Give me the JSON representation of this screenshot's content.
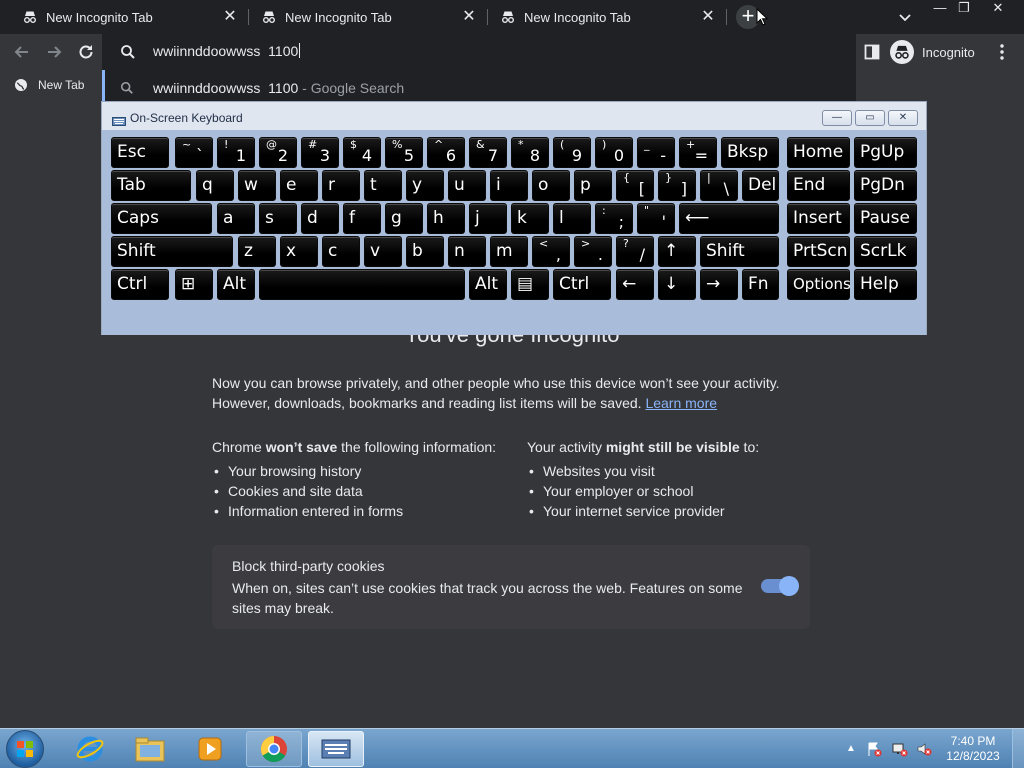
{
  "browser": {
    "tabs": [
      {
        "title": "New Incognito Tab",
        "close": "✕"
      },
      {
        "title": "New Incognito Tab",
        "close": "✕"
      },
      {
        "title": "New Incognito Tab",
        "close": "✕"
      }
    ],
    "new_tab_symbol": "+",
    "window_controls": {
      "minimize": "—",
      "maximize": "❐",
      "close": "✕"
    },
    "omnibox": {
      "value": "wwiinnddoowwss  1100"
    },
    "incognito_label": "Incognito",
    "bookmarks": [
      {
        "label": "New Tab"
      }
    ],
    "suggestion": {
      "query": "wwiinnddoowwss  1100",
      "suffix": " - Google Search"
    },
    "colors": {
      "tabstrip": "#202124",
      "toolbar": "#35363a",
      "accent": "#8ab4f8"
    }
  },
  "page": {
    "heading": "You've gone Incognito",
    "intro_line1": "Now you can browse privately, and other people who use this device won’t see your activity.",
    "intro_line2": "However, downloads, bookmarks and reading list items will be saved. ",
    "learn_more": "Learn more",
    "not_saved": {
      "heading_prefix": "Chrome ",
      "heading_bold": "won’t save",
      "heading_suffix": " the following information:",
      "items": [
        "Your browsing history",
        "Cookies and site data",
        "Information entered in forms"
      ]
    },
    "still_visible": {
      "heading_prefix": "Your activity ",
      "heading_bold": "might still be visible",
      "heading_suffix": " to:",
      "items": [
        "Websites you visit",
        "Your employer or school",
        "Your internet service provider"
      ]
    },
    "cookies": {
      "title": "Block third-party cookies",
      "desc": "When on, sites can’t use cookies that track you across the web. Features on some sites may break.",
      "toggle_on": true
    }
  },
  "osk": {
    "title": "On-Screen Keyboard",
    "controls": {
      "minimize": "—",
      "restore": "▭",
      "close": "✕"
    },
    "rows": [
      [
        {
          "main": "Esc"
        },
        {
          "shift": "~",
          "low": "`"
        },
        {
          "shift": "!",
          "low": "1"
        },
        {
          "shift": "@",
          "low": "2"
        },
        {
          "shift": "#",
          "low": "3"
        },
        {
          "shift": "$",
          "low": "4"
        },
        {
          "shift": "%",
          "low": "5"
        },
        {
          "shift": "^",
          "low": "6"
        },
        {
          "shift": "&",
          "low": "7"
        },
        {
          "shift": "*",
          "low": "8"
        },
        {
          "shift": "(",
          "low": "9"
        },
        {
          "shift": ")",
          "low": "0"
        },
        {
          "shift": "_",
          "low": "-"
        },
        {
          "shift": "+",
          "low": "="
        },
        {
          "main": "Bksp"
        },
        {
          "main": "Home"
        },
        {
          "main": "PgUp"
        }
      ],
      [
        {
          "main": "Tab"
        },
        {
          "main": "q"
        },
        {
          "main": "w"
        },
        {
          "main": "e"
        },
        {
          "main": "r"
        },
        {
          "main": "t"
        },
        {
          "main": "y"
        },
        {
          "main": "u"
        },
        {
          "main": "i"
        },
        {
          "main": "o"
        },
        {
          "main": "p"
        },
        {
          "shift": "{",
          "low": "["
        },
        {
          "shift": "}",
          "low": "]"
        },
        {
          "shift": "|",
          "low": "\\"
        },
        {
          "main": "Del"
        },
        {
          "main": "End"
        },
        {
          "main": "PgDn"
        }
      ],
      [
        {
          "main": "Caps"
        },
        {
          "main": "a"
        },
        {
          "main": "s"
        },
        {
          "main": "d"
        },
        {
          "main": "f"
        },
        {
          "main": "g"
        },
        {
          "main": "h"
        },
        {
          "main": "j"
        },
        {
          "main": "k"
        },
        {
          "main": "l"
        },
        {
          "shift": ":",
          "low": ";"
        },
        {
          "shift": "\"",
          "low": "'"
        },
        {
          "main": "⟵"
        },
        {
          "main": "Insert"
        },
        {
          "main": "Pause"
        }
      ],
      [
        {
          "main": "Shift"
        },
        {
          "main": "z"
        },
        {
          "main": "x"
        },
        {
          "main": "c"
        },
        {
          "main": "v"
        },
        {
          "main": "b"
        },
        {
          "main": "n"
        },
        {
          "main": "m"
        },
        {
          "shift": "<",
          "low": ","
        },
        {
          "shift": ">",
          "low": "."
        },
        {
          "shift": "?",
          "low": "/"
        },
        {
          "main": "↑"
        },
        {
          "main": "Shift"
        },
        {
          "main": "PrtScn"
        },
        {
          "main": "ScrLk"
        }
      ],
      [
        {
          "main": "Ctrl"
        },
        {
          "main": "⊞"
        },
        {
          "main": "Alt"
        },
        {
          "main": ""
        },
        {
          "main": "Alt"
        },
        {
          "main": "▤"
        },
        {
          "main": "Ctrl"
        },
        {
          "main": "←"
        },
        {
          "main": "↓"
        },
        {
          "main": "→"
        },
        {
          "main": "Fn"
        },
        {
          "main": "Options"
        },
        {
          "main": "Help"
        }
      ]
    ]
  },
  "taskbar": {
    "apps": [
      "internet-explorer",
      "file-explorer",
      "media-player",
      "chrome",
      "on-screen-keyboard"
    ],
    "time": "7:40 PM",
    "date": "12/8/2023"
  }
}
